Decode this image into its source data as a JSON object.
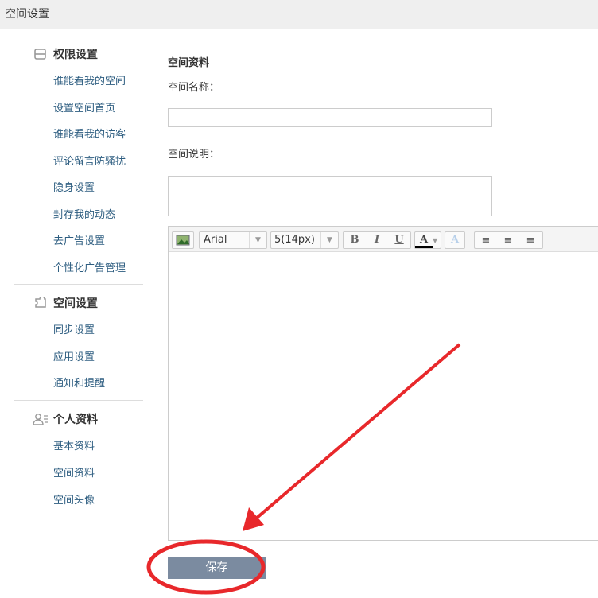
{
  "header": {
    "title": "空间设置"
  },
  "sidebar": {
    "groups": [
      {
        "title": "权限设置",
        "icon": "lock-icon",
        "items": [
          "谁能看我的空间",
          "设置空间首页",
          "谁能看我的访客",
          "评论留言防骚扰",
          "隐身设置",
          "封存我的动态",
          "去广告设置",
          "个性化广告管理"
        ]
      },
      {
        "title": "空间设置",
        "icon": "puzzle-icon",
        "items": [
          "同步设置",
          "应用设置",
          "通知和提醒"
        ]
      },
      {
        "title": "个人资料",
        "icon": "user-card-icon",
        "items": [
          "基本资料",
          "空间资料",
          "空间头像"
        ]
      }
    ]
  },
  "main": {
    "section_title": "空间资料",
    "name_label": "空间名称：",
    "name_value": "",
    "desc_label": "空间说明：",
    "desc_value": "",
    "toolbar": {
      "font": "Arial",
      "size": "5(14px)",
      "bold": "B",
      "italic": "I",
      "underline": "U",
      "color": "A",
      "shadow": "A"
    },
    "save_label": "保存"
  },
  "colors": {
    "annotation": "#e8282b",
    "save_button": "#7b8ba0",
    "link": "#2d5d80"
  }
}
